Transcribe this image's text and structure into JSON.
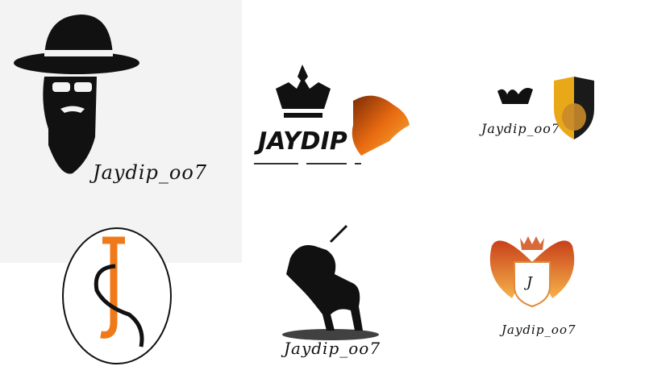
{
  "collage": {
    "hat_logo": {
      "caption": "Jaydip_oo7",
      "icon": "bearded-man-hat-icon"
    },
    "crown_tiger_logo": {
      "caption": "JAYDIP",
      "icons": [
        "crown-icon",
        "fire-tiger-icon"
      ]
    },
    "crown_lion_logo": {
      "caption": "Jaydip_oo7",
      "icons": [
        "crown-icon",
        "lion-shield-icon"
      ]
    },
    "js_monogram_logo": {
      "letters": "JS",
      "accent": "#f07a1a"
    },
    "horse_warrior_logo": {
      "caption": "Jaydip_oo7",
      "icon": "horse-warrior-icon"
    },
    "winged_crest_logo": {
      "caption": "Jaydip_oo7",
      "initial": "J",
      "icon": "winged-shield-icon",
      "accent": "#f08a24"
    }
  }
}
